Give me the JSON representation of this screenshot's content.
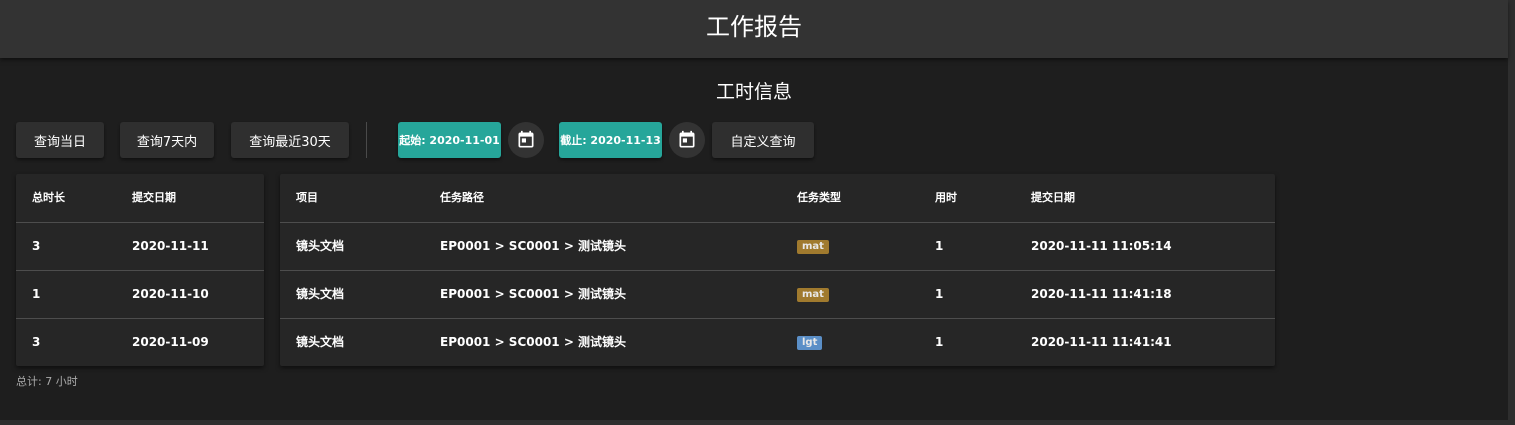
{
  "app": {
    "title": "工作报告"
  },
  "section": {
    "title": "工时信息"
  },
  "toolbar": {
    "today_label": "查询当日",
    "week_label": "查询7天内",
    "month_label": "查询最近30天",
    "start_label": "起始: 2020-11-01",
    "end_label": "截止: 2020-11-13",
    "custom_label": "自定义查询",
    "calendar_icon": "calendar-icon"
  },
  "summary_table": {
    "headers": [
      "总时长",
      "提交日期"
    ],
    "rows": [
      [
        "3",
        "2020-11-11"
      ],
      [
        "1",
        "2020-11-10"
      ],
      [
        "3",
        "2020-11-09"
      ]
    ]
  },
  "detail_table": {
    "headers": [
      "项目",
      "任务路径",
      "任务类型",
      "用时",
      "提交日期"
    ],
    "rows": [
      {
        "project": "镜头文档",
        "path": "EP0001 > SC0001 > 测试镜头",
        "type": "mat",
        "type_color": "#a07a2e",
        "time": "1",
        "date": "2020-11-11 11:05:14"
      },
      {
        "project": "镜头文档",
        "path": "EP0001 > SC0001 > 测试镜头",
        "type": "mat",
        "type_color": "#a07a2e",
        "time": "1",
        "date": "2020-11-11 11:41:18"
      },
      {
        "project": "镜头文档",
        "path": "EP0001 > SC0001 > 测试镜头",
        "type": "lgt",
        "type_color": "#5b8fc7",
        "time": "1",
        "date": "2020-11-11 11:41:41"
      }
    ]
  },
  "total": {
    "label": "总计: 7 小时"
  },
  "colors": {
    "accent": "#26a69a",
    "background": "#1e1e1e",
    "app_bar": "#333333"
  }
}
